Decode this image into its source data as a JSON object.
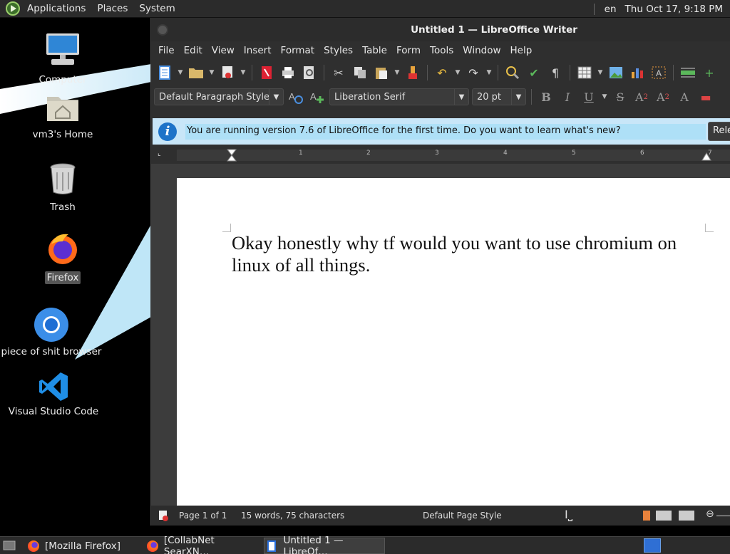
{
  "top_panel": {
    "menus": [
      "Applications",
      "Places",
      "System"
    ],
    "keyboard_layout": "en",
    "clock": "Thu Oct 17,  9:18 PM"
  },
  "desktop": {
    "icons": [
      {
        "label": "Computer",
        "icon": "computer-icon"
      },
      {
        "label": "vm3's Home",
        "icon": "home-folder-icon"
      },
      {
        "label": "Trash",
        "icon": "trash-icon"
      },
      {
        "label": "Firefox",
        "icon": "firefox-icon"
      },
      {
        "label": "piece of shit browser",
        "icon": "chromium-icon"
      },
      {
        "label": "Visual Studio Code",
        "icon": "vscode-icon"
      }
    ]
  },
  "writer": {
    "title": "Untitled 1 — LibreOffice Writer",
    "menu": [
      "File",
      "Edit",
      "View",
      "Insert",
      "Format",
      "Styles",
      "Table",
      "Form",
      "Tools",
      "Window",
      "Help"
    ],
    "paragraph_style": "Default Paragraph Style",
    "font_name": "Liberation Serif",
    "font_size": "20 pt",
    "infobar_message": "You are running version 7.6 of LibreOffice for the first time. Do you want to learn what's new?",
    "infobar_button": "Rele",
    "ruler_numbers": [
      "1",
      "2",
      "3",
      "4",
      "5",
      "6",
      "7"
    ],
    "document_text": "Okay honestly why tf would you want to use chromium on linux of all things.",
    "status": {
      "page": "Page 1 of 1",
      "words": "15 words, 75 characters",
      "page_style": "Default Page Style"
    }
  },
  "taskbar": {
    "tasks": [
      "[Mozilla Firefox]",
      "[CollabNet SearXN…",
      "Untitled 1 — LibreOf…"
    ]
  }
}
